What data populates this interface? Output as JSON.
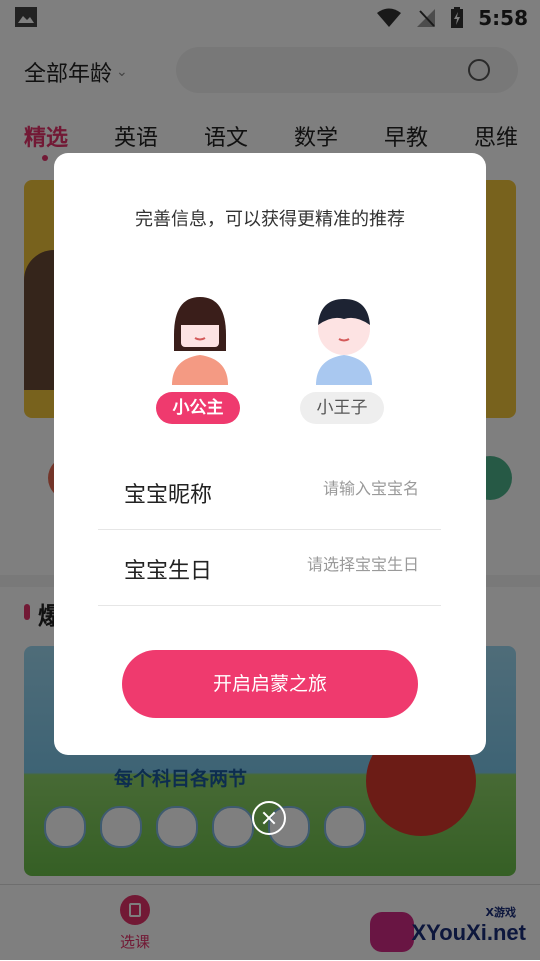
{
  "status_bar": {
    "time": "5:58"
  },
  "header": {
    "age_filter_label": "全部年龄"
  },
  "tabs": [
    {
      "label": "精选"
    },
    {
      "label": "英语"
    },
    {
      "label": "语文"
    },
    {
      "label": "数学"
    },
    {
      "label": "早教"
    },
    {
      "label": "思维"
    }
  ],
  "background": {
    "section_title_visible": "爆",
    "poster_text": "每个科目各两节"
  },
  "dialog": {
    "title": "完善信息，可以获得更精准的推荐",
    "gender_options": [
      {
        "label": "小公主"
      },
      {
        "label": "小王子"
      }
    ],
    "nickname": {
      "label": "宝宝昵称",
      "placeholder": "请输入宝宝名"
    },
    "birthday": {
      "label": "宝宝生日",
      "placeholder": "请选择宝宝生日"
    },
    "start_button": "开启启蒙之旅"
  },
  "bottom_nav": {
    "items": [
      {
        "label": "选课"
      }
    ]
  },
  "watermark": {
    "small": "X游戏",
    "text": "XYouXi.net"
  },
  "colors": {
    "accent": "#ef3a6e",
    "overlay": "rgba(0,0,0,0.5)"
  }
}
